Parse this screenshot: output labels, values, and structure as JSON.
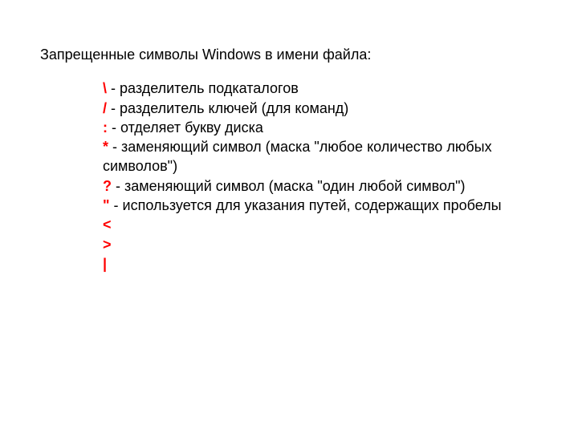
{
  "heading": "Запрещенные символы Windows в имени файла:",
  "items": [
    {
      "symbol": "\\",
      "desc": " - разделитель подкаталогов"
    },
    {
      "symbol": "/",
      "desc": " - разделитель ключей (для команд)"
    },
    {
      "symbol": ":",
      "desc": " - отделяет букву диска"
    },
    {
      "symbol": "*",
      "desc": " - заменяющий символ (маска \"любое количество любых символов\")"
    },
    {
      "symbol": "?",
      "desc": " - заменяющий символ (маска \"один любой символ\")"
    },
    {
      "symbol": "\"",
      "desc": " - используется для указания путей, содержащих пробелы"
    },
    {
      "symbol": "<",
      "desc": ""
    },
    {
      "symbol": ">",
      "desc": ""
    },
    {
      "symbol": "|",
      "desc": ""
    }
  ]
}
